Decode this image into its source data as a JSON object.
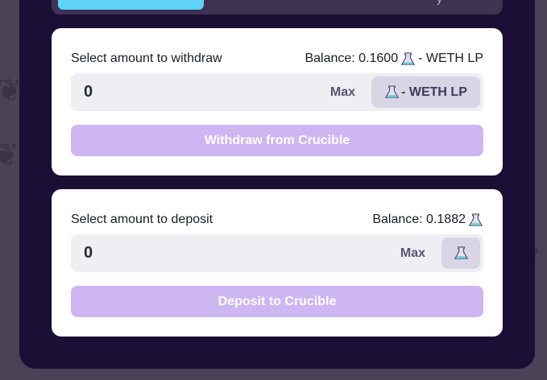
{
  "tabs": {
    "partial_label": "y"
  },
  "withdraw": {
    "label": "Select amount to withdraw",
    "balance_prefix": "Balance: 0.1600",
    "balance_suffix": "- WETH LP",
    "amount_value": "0",
    "max_label": "Max",
    "token_label": "- WETH LP",
    "token_icon": "flask-icon",
    "button_label": "Withdraw from Crucible"
  },
  "deposit": {
    "label": "Select amount to deposit",
    "balance_prefix": "Balance: 0.1882",
    "amount_value": "0",
    "max_label": "Max",
    "token_icon": "flask-icon",
    "button_label": "Deposit to Crucible"
  },
  "colors": {
    "panel_bg": "#1c0f36",
    "card_bg": "#ffffff",
    "tab_active": "#5fd3f5",
    "button_disabled": "#cdb6f1"
  }
}
